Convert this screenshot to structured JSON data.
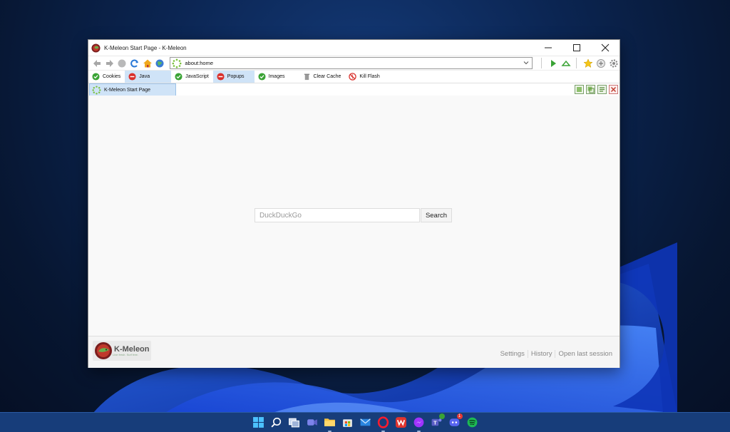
{
  "window": {
    "title": "K-Meleon Start Page - K-Meleon"
  },
  "navbar": {
    "url": "about:home"
  },
  "privacy_bar": {
    "items": [
      {
        "label": "Cookies",
        "state": "enabled",
        "icon": "green-check-icon"
      },
      {
        "label": "Java",
        "state": "disabled",
        "icon": "red-block-icon"
      },
      {
        "label": "JavaScript",
        "state": "enabled",
        "icon": "green-check-icon"
      },
      {
        "label": "Popups",
        "state": "disabled",
        "icon": "red-block-icon"
      },
      {
        "label": "Images",
        "state": "enabled",
        "icon": "green-check-icon"
      },
      {
        "label": "Clear Cache",
        "icon": "trash-icon"
      },
      {
        "label": "Kill Flash",
        "icon": "no-flash-icon"
      }
    ]
  },
  "tabs": [
    {
      "label": "K-Meleon Start Page",
      "active": true
    }
  ],
  "search": {
    "placeholder": "DuckDuckGo",
    "button_label": "Search"
  },
  "footer": {
    "logo_text": "K-Meleon",
    "logo_tagline": "Live fresh. Surf free.",
    "links": [
      "Settings",
      "History",
      "Open last session"
    ]
  },
  "colors": {
    "tab_active": "#cfe3f7",
    "taskbar": "#173d7a",
    "accent_green": "#3aa335",
    "accent_red": "#d9302c"
  },
  "taskbar": {
    "icons": [
      "windows-start-icon",
      "search-icon",
      "task-view-icon",
      "chat-icon",
      "file-explorer-icon",
      "store-icon",
      "mail-icon",
      "opera-icon",
      "wps-office-icon",
      "messenger-icon",
      "teams-icon",
      "discord-icon",
      "spotify-icon"
    ],
    "discord_badge": "1"
  }
}
